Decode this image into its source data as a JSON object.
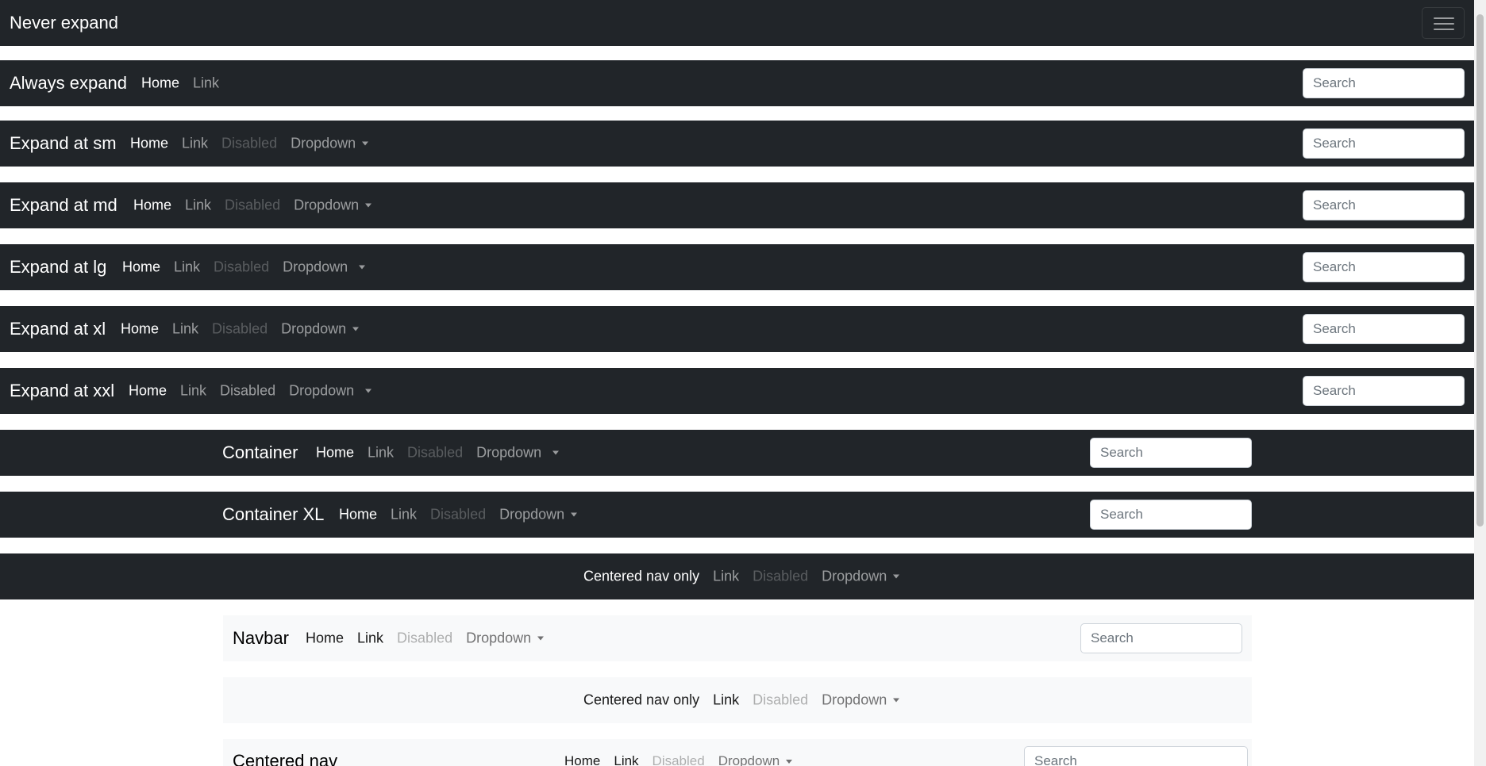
{
  "navbars": {
    "never_expand": {
      "brand": "Never expand"
    },
    "always_expand": {
      "brand": "Always expand",
      "home": "Home",
      "link": "Link",
      "search_placeholder": "Search"
    },
    "expand_sm": {
      "brand": "Expand at sm",
      "home": "Home",
      "link": "Link",
      "disabled": "Disabled",
      "dropdown": "Dropdown",
      "search_placeholder": "Search"
    },
    "expand_md": {
      "brand": "Expand at md",
      "home": "Home",
      "link": "Link",
      "disabled": "Disabled",
      "dropdown": "Dropdown",
      "search_placeholder": "Search"
    },
    "expand_lg": {
      "brand": "Expand at lg",
      "home": "Home",
      "link": "Link",
      "disabled": "Disabled",
      "dropdown": "Dropdown",
      "search_placeholder": "Search"
    },
    "expand_xl": {
      "brand": "Expand at xl",
      "home": "Home",
      "link": "Link",
      "disabled": "Disabled",
      "dropdown": "Dropdown",
      "search_placeholder": "Search"
    },
    "expand_xxl": {
      "brand": "Expand at xxl",
      "home": "Home",
      "link": "Link",
      "disabled": "Disabled",
      "dropdown": "Dropdown",
      "search_placeholder": "Search"
    },
    "container": {
      "brand": "Container",
      "home": "Home",
      "link": "Link",
      "disabled": "Disabled",
      "dropdown": "Dropdown",
      "search_placeholder": "Search"
    },
    "container_xl": {
      "brand": "Container XL",
      "home": "Home",
      "link": "Link",
      "disabled": "Disabled",
      "dropdown": "Dropdown",
      "search_placeholder": "Search"
    },
    "centered_dark": {
      "active": "Centered nav only",
      "link": "Link",
      "disabled": "Disabled",
      "dropdown": "Dropdown"
    },
    "light_navbar": {
      "brand": "Navbar",
      "home": "Home",
      "link": "Link",
      "disabled": "Disabled",
      "dropdown": "Dropdown",
      "search_placeholder": "Search"
    },
    "centered_light": {
      "active": "Centered nav only",
      "link": "Link",
      "disabled": "Disabled",
      "dropdown": "Dropdown"
    },
    "centered_nav": {
      "brand": "Centered nav",
      "home": "Home",
      "link": "Link",
      "disabled": "Disabled",
      "dropdown": "Dropdown",
      "search_placeholder": "Search"
    }
  },
  "colors": {
    "dark_bg": "#212529",
    "light_bg": "#f8f9fa"
  },
  "icons": {
    "toggler": "hamburger-icon",
    "dropdown": "caret-down-icon"
  }
}
